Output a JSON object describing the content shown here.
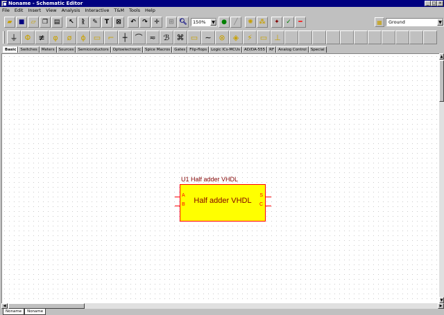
{
  "window": {
    "title": "Noname - Schematic Editor",
    "minimize": "_",
    "maximize": "□",
    "close": "×"
  },
  "menu": [
    "File",
    "Edit",
    "Insert",
    "View",
    "Analysis",
    "Interactive",
    "T&M",
    "Tools",
    "Help"
  ],
  "toolbar": {
    "zoom_value": "150%",
    "ground_value": "Ground"
  },
  "component_tabs": [
    "Basic",
    "Switches",
    "Meters",
    "Sources",
    "Semiconductors",
    "Optoelectronic",
    "Spice Macros",
    "Gates",
    "Flip-flops",
    "Logic ICs-MCUs",
    "AD/DA-555",
    "RF",
    "Analog Control",
    "Special"
  ],
  "component": {
    "label": "U1 Half adder VHDL",
    "name": "Half adder VHDL",
    "pins_left": [
      "A",
      "B"
    ],
    "pins_right": [
      "S",
      "C"
    ]
  },
  "sheet_tabs": [
    "Noname",
    "Noname"
  ]
}
